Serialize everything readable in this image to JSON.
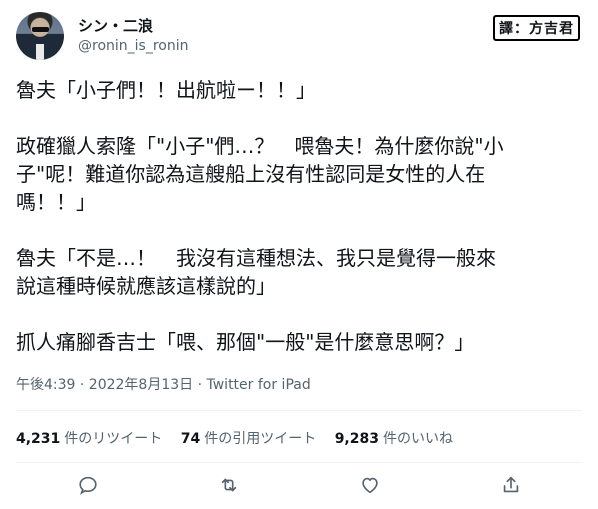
{
  "author": {
    "name": "シン・二浪",
    "handle": "@ronin_is_ronin",
    "avatar_icon": "profile-photo-icon"
  },
  "watermark": "譯：方吉君",
  "tweet": {
    "paragraphs": [
      [
        "魯夫「小子們！！出航啦ー！！」"
      ],
      [
        "政確獵人索隆「\"小子\"們…？　喂魯夫！為什麼你說\"小",
        "子\"呢！難道你認為這艘船上沒有性認同是女性的人在",
        "嗎！！」"
      ],
      [
        "魯夫「不是…！　我沒有這種想法、我只是覺得一般來",
        "說這種時候就應該這樣說的」"
      ],
      [
        "抓人痛腳香吉士「喂、那個\"一般\"是什麼意思啊？」"
      ]
    ]
  },
  "meta": "午後4:39 · 2022年8月13日 · Twitter for iPad",
  "stats": [
    {
      "num": "4,231",
      "label": "件のリツイート"
    },
    {
      "num": "74",
      "label": "件の引用ツイート"
    },
    {
      "num": "9,283",
      "label": "件のいいね"
    }
  ],
  "actions": [
    {
      "name": "reply-icon"
    },
    {
      "name": "retweet-icon"
    },
    {
      "name": "like-icon"
    },
    {
      "name": "share-icon"
    }
  ],
  "colors": {
    "text": "#0f1419",
    "secondary": "#536471",
    "divider": "#eff3f4"
  }
}
